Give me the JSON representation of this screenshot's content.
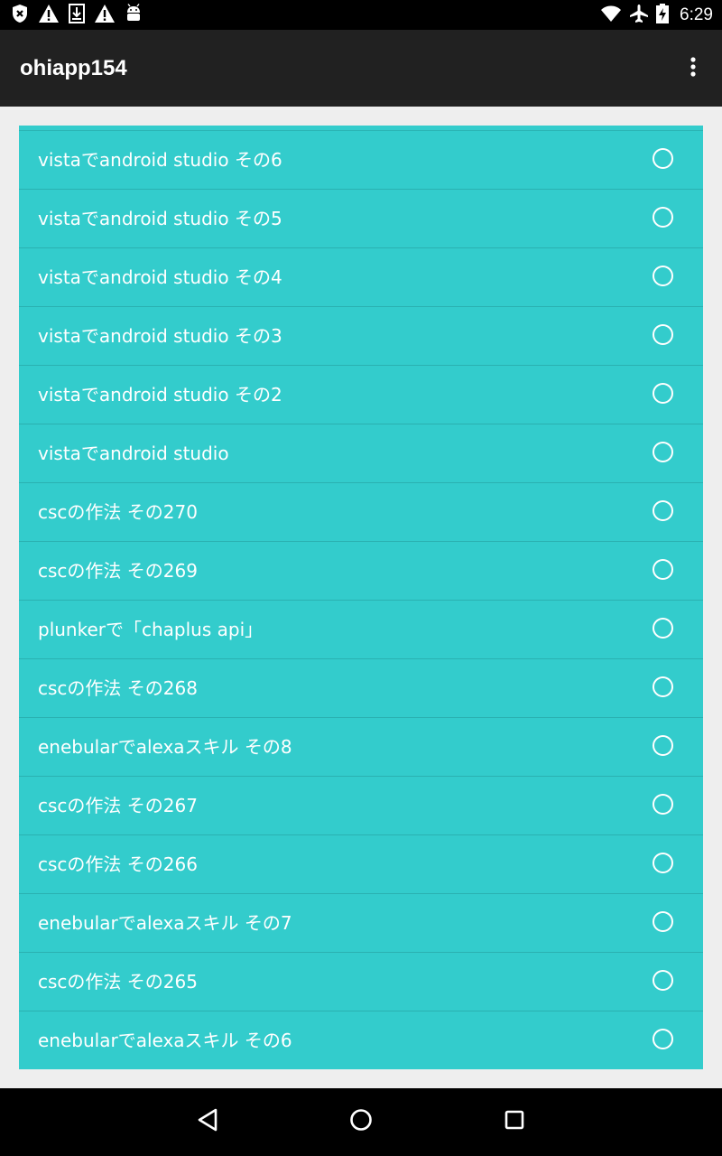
{
  "status_bar": {
    "time": "6:29",
    "left_icons": [
      "shield-icon",
      "warning-icon",
      "download-icon",
      "warning-icon",
      "android-icon"
    ],
    "right_icons": [
      "wifi-icon",
      "airplane-icon",
      "battery-charging-icon"
    ]
  },
  "app_bar": {
    "title": "ohiapp154",
    "overflow_icon": "more-vert-icon"
  },
  "list": {
    "items": [
      {
        "label": "vistaでandroid studio その6",
        "selected": false
      },
      {
        "label": "vistaでandroid studio その5",
        "selected": false
      },
      {
        "label": "vistaでandroid studio その4",
        "selected": false
      },
      {
        "label": "vistaでandroid studio その3",
        "selected": false
      },
      {
        "label": "vistaでandroid studio その2",
        "selected": false
      },
      {
        "label": "vistaでandroid studio",
        "selected": false
      },
      {
        "label": "cscの作法 その270",
        "selected": false
      },
      {
        "label": "cscの作法 その269",
        "selected": false
      },
      {
        "label": "plunkerで「chaplus api」",
        "selected": false
      },
      {
        "label": "cscの作法 その268",
        "selected": false
      },
      {
        "label": "enebularでalexaスキル その8",
        "selected": false
      },
      {
        "label": "cscの作法 その267",
        "selected": false
      },
      {
        "label": "cscの作法 その266",
        "selected": false
      },
      {
        "label": "enebularでalexaスキル その7",
        "selected": false
      },
      {
        "label": "cscの作法 その265",
        "selected": false
      },
      {
        "label": "enebularでalexaスキル その6",
        "selected": false
      }
    ]
  },
  "nav_bar": {
    "icons": [
      "back-icon",
      "home-icon",
      "recents-icon"
    ]
  },
  "colors": {
    "list_background": "#33cccc",
    "app_bar": "#212121",
    "page_background": "#eeeeee"
  }
}
